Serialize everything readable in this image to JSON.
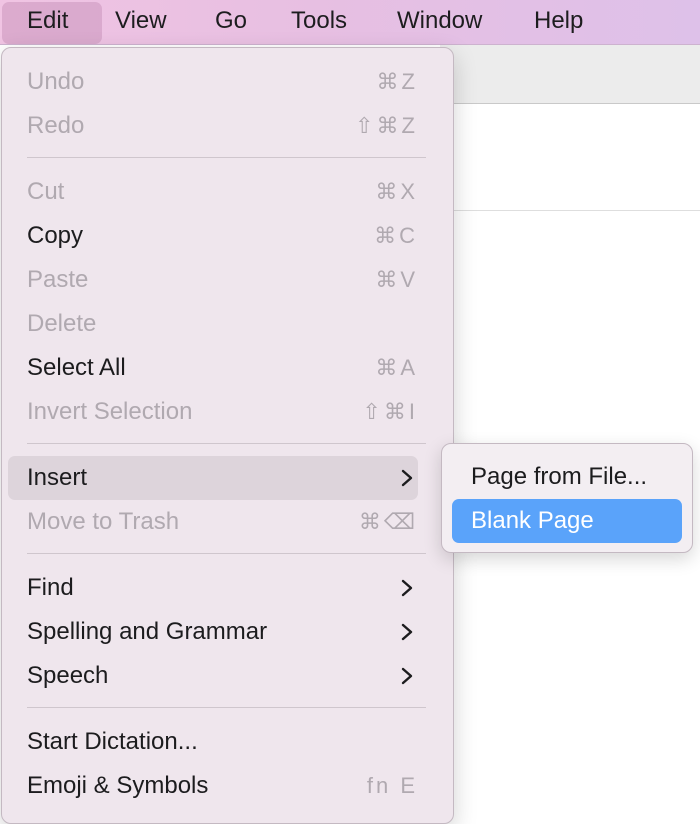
{
  "menubar": {
    "items": [
      "Edit",
      "View",
      "Go",
      "Tools",
      "Window",
      "Help"
    ],
    "active": "Edit"
  },
  "edit_menu": {
    "items": [
      {
        "label": "Undo",
        "shortcut": "⌘Z",
        "enabled": false
      },
      {
        "label": "Redo",
        "shortcut": "⇧⌘Z",
        "enabled": false
      },
      {
        "label": "Cut",
        "shortcut": "⌘X",
        "enabled": false
      },
      {
        "label": "Copy",
        "shortcut": "⌘C",
        "enabled": true
      },
      {
        "label": "Paste",
        "shortcut": "⌘V",
        "enabled": false
      },
      {
        "label": "Delete",
        "shortcut": "",
        "enabled": false
      },
      {
        "label": "Select All",
        "shortcut": "⌘A",
        "enabled": true
      },
      {
        "label": "Invert Selection",
        "shortcut": "⇧⌘I",
        "enabled": false
      },
      {
        "label": "Insert",
        "shortcut": "",
        "enabled": true,
        "submenu": true,
        "highlighted": true
      },
      {
        "label": "Move to Trash",
        "shortcut": "⌘⌫",
        "enabled": false
      },
      {
        "label": "Find",
        "shortcut": "",
        "enabled": true,
        "submenu": true
      },
      {
        "label": "Spelling and Grammar",
        "shortcut": "",
        "enabled": true,
        "submenu": true
      },
      {
        "label": "Speech",
        "shortcut": "",
        "enabled": true,
        "submenu": true
      },
      {
        "label": "Start Dictation...",
        "shortcut": "",
        "enabled": true
      },
      {
        "label": "Emoji & Symbols",
        "shortcut": "fn E",
        "enabled": true
      }
    ]
  },
  "insert_submenu": {
    "items": [
      {
        "label": "Page from File...",
        "selected": false
      },
      {
        "label": "Blank Page",
        "selected": true
      }
    ]
  },
  "colors": {
    "selection_blue": "#5aa3fa",
    "hover_gray": "#ddd4db",
    "disabled_text": "#b0a9b0"
  }
}
